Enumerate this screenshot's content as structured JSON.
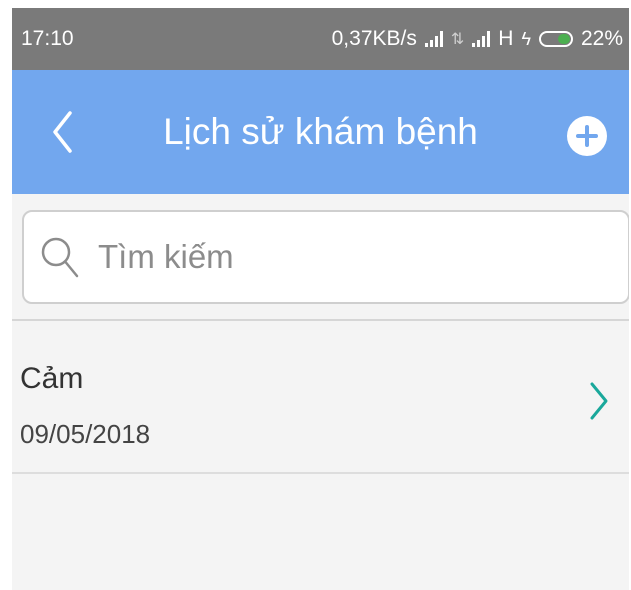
{
  "status_bar": {
    "time": "17:10",
    "network_speed": "0,37KB/s",
    "network_type": "H",
    "battery": "22%",
    "icons": [
      "signal-icon",
      "data-arrows-icon",
      "signal-icon",
      "charging-icon",
      "battery-icon"
    ]
  },
  "header": {
    "title": "Lịch sử khám bệnh",
    "back_icon": "chevron-left-icon",
    "add_icon": "plus-circle-icon",
    "background_color": "#72a7ee"
  },
  "search": {
    "placeholder": "Tìm kiếm",
    "value": "",
    "icon": "search-icon"
  },
  "history": [
    {
      "title": "Cảm",
      "date": "09/05/2018",
      "chevron_color": "#1aa89b"
    }
  ]
}
